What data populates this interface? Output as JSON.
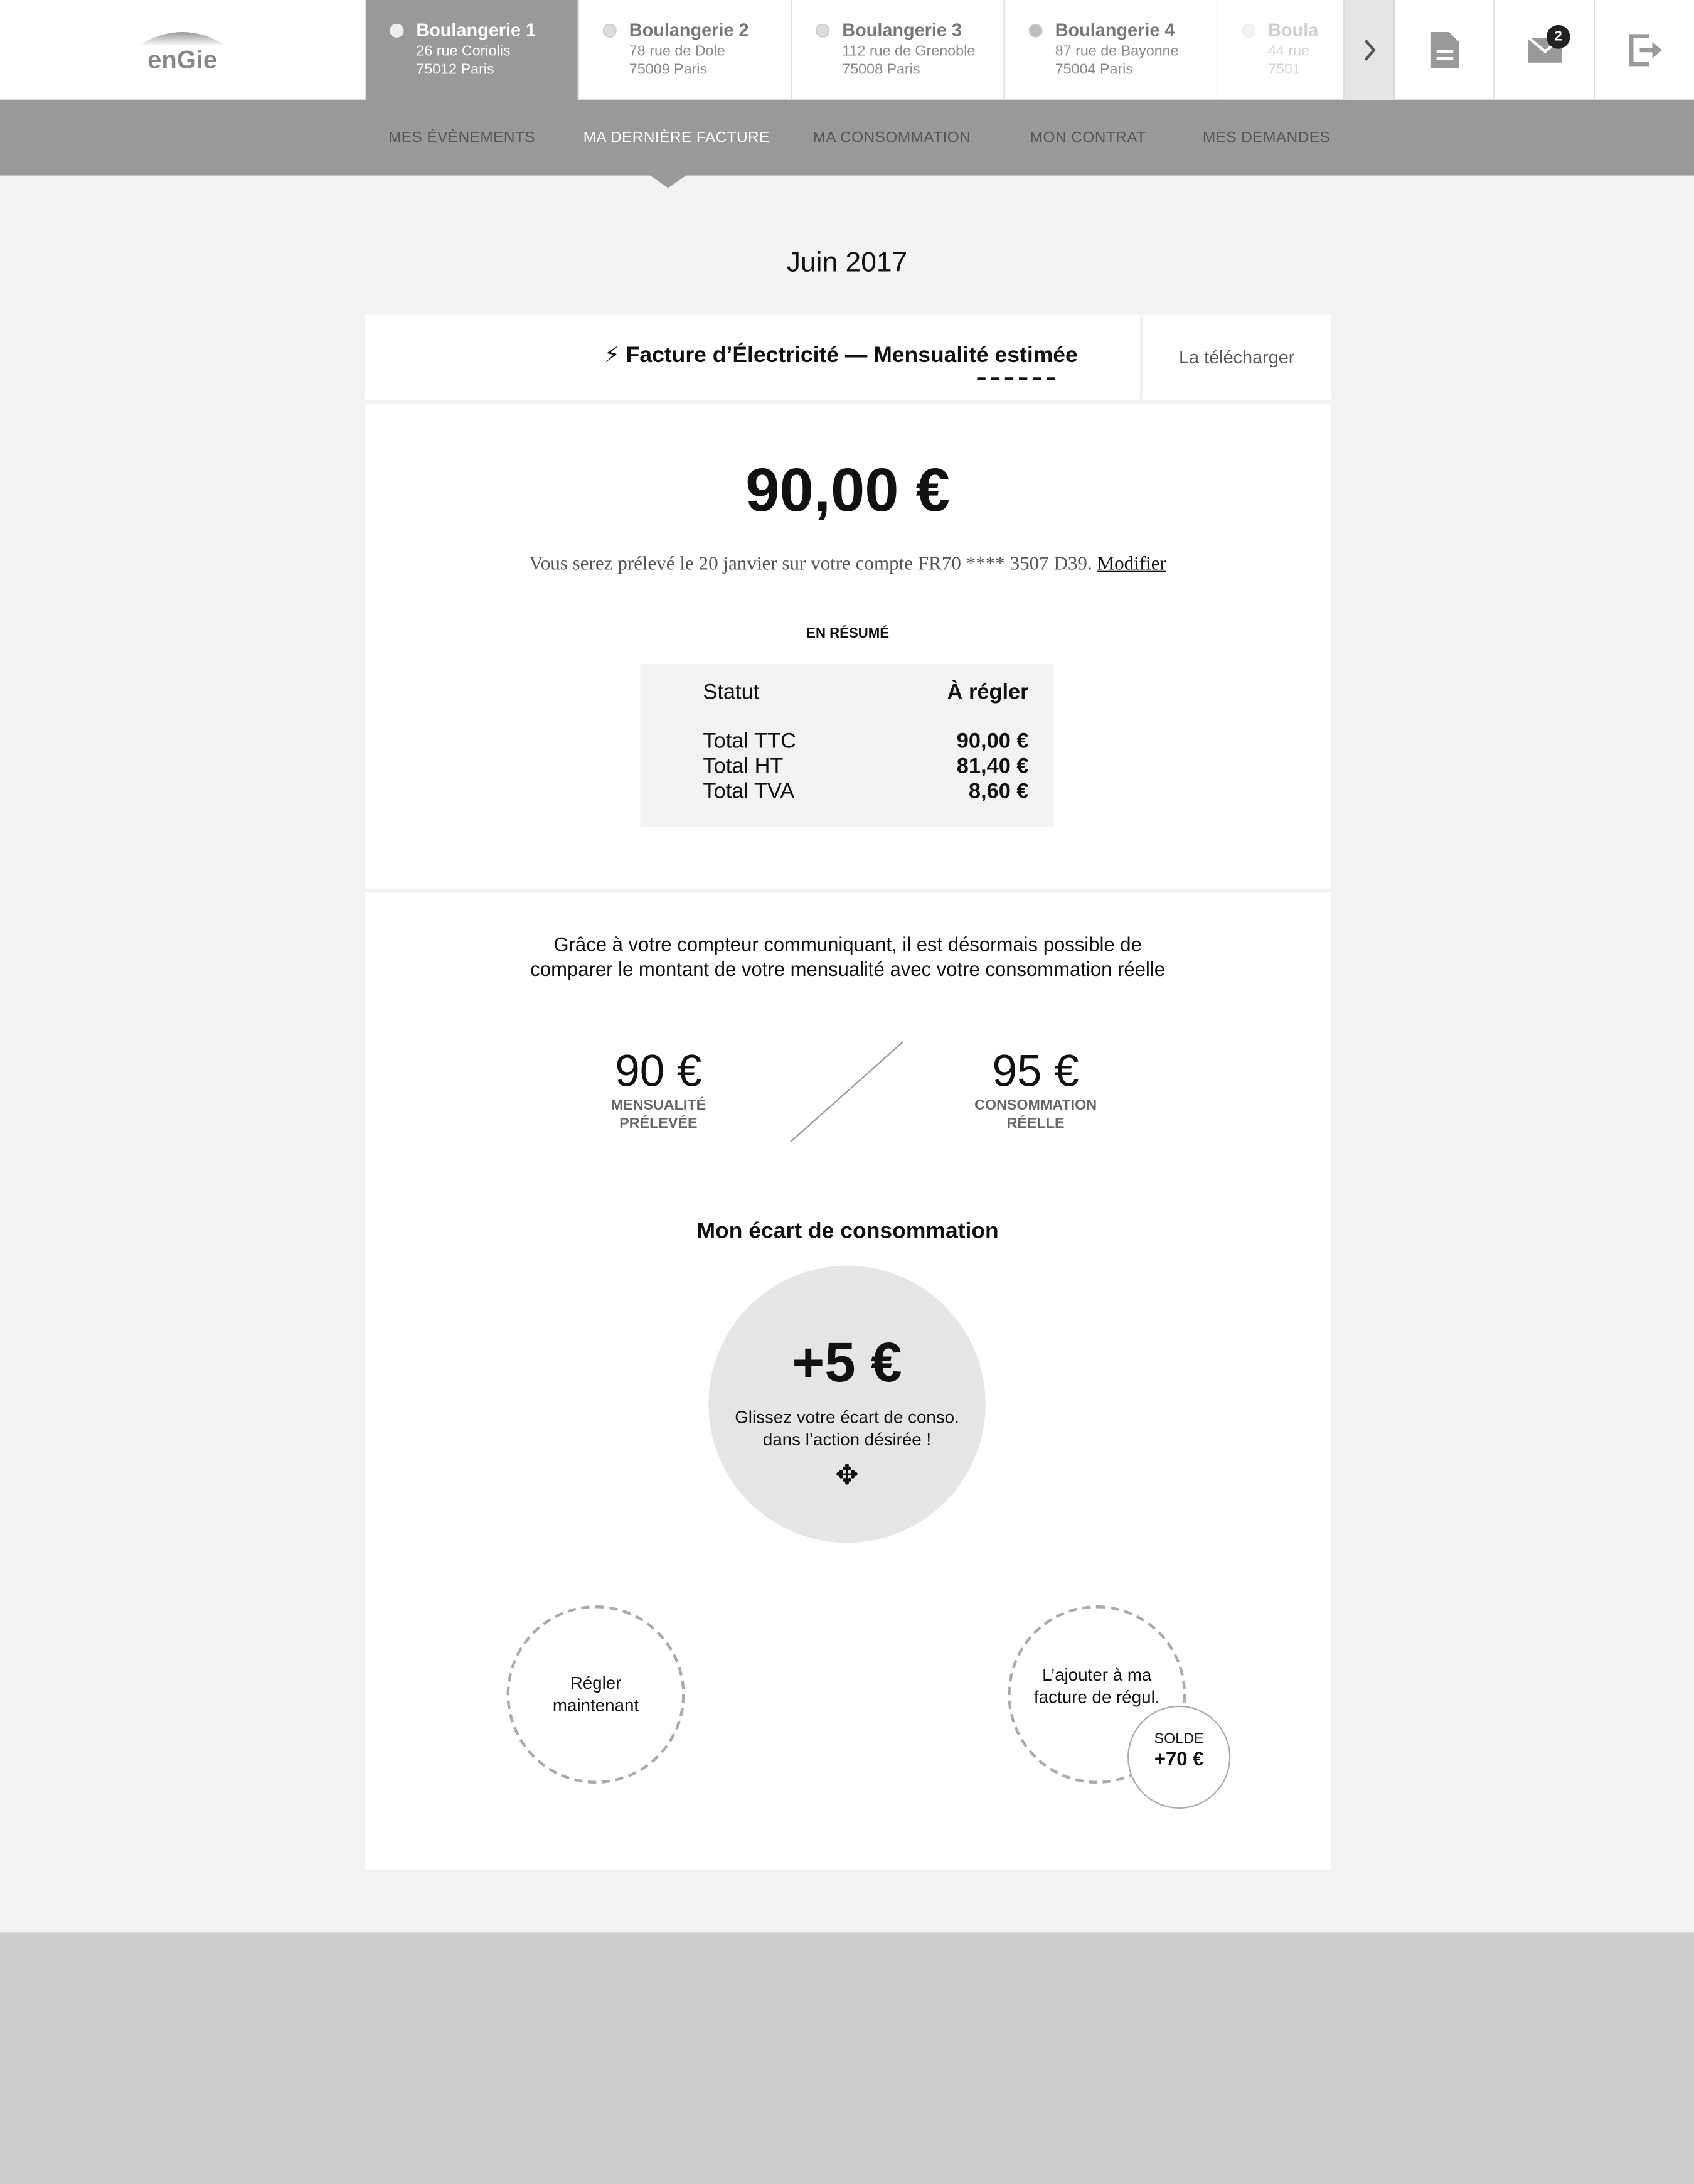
{
  "header": {
    "logo": "engie",
    "sites": [
      {
        "name": "Boulangerie 1",
        "street": "26 rue Coriolis",
        "city": "75012 Paris",
        "active": true
      },
      {
        "name": "Boulangerie 2",
        "street": "78 rue de Dole",
        "city": "75009 Paris"
      },
      {
        "name": "Boulangerie 3",
        "street": "112 rue de Grenoble",
        "city": "75008 Paris"
      },
      {
        "name": "Boulangerie 4",
        "street": "87 rue de Bayonne",
        "city": "75004 Paris"
      },
      {
        "name": "Boula",
        "street": "44 rue",
        "city": "7501"
      }
    ],
    "icons": [
      "chevron-right-icon",
      "document-icon",
      "mail-icon",
      "logout-icon"
    ],
    "mail_badge": "2"
  },
  "nav": {
    "items": [
      "MES ÉVÈNEMENTS",
      "MA DERNIÈRE FACTURE",
      "MA CONSOMMATION",
      "MON CONTRAT",
      "MES DEMANDES"
    ],
    "active": 1
  },
  "period": "Juin 2017",
  "invoice": {
    "title": "Facture d’Électricité — Mensualité estimée",
    "download": "La télécharger",
    "amount": "90,00 €",
    "debit_text": "Vous serez prélevé le 20 janvier sur votre compte FR70 **** 3507 D39.",
    "modify": "Modifier",
    "summary_title": "EN RÉSUMÉ",
    "status_label": "Statut",
    "status_value": "À régler",
    "rows": [
      {
        "label": "Total TTC",
        "value": "90,00 €"
      },
      {
        "label": "Total HT",
        "value": "81,40 €"
      },
      {
        "label": "Total TVA",
        "value": "8,60 €"
      }
    ]
  },
  "compare": {
    "intro1": "Grâce à votre compteur communiquant, il est désormais possible de",
    "intro2": "comparer le montant de votre mensualité avec votre consommation réelle",
    "left_value": "90 €",
    "left_label1": "MENSUALITÉ",
    "left_label2": "PRÉLEVÉE",
    "right_value": "95 €",
    "right_label1": "CONSOMMATION",
    "right_label2": "RÉELLE",
    "gap_title": "Mon écart de consommation",
    "gap_value": "+5 €",
    "gap_hint1": "Glissez votre écart de conso.",
    "gap_hint2": "dans l’action désirée !",
    "action1_l1": "Régler",
    "action1_l2": "maintenant",
    "action2_l1": "L’ajouter à ma",
    "action2_l2": "facture de régul.",
    "balance_label": "SOLDE",
    "balance_value": "+70 €"
  }
}
